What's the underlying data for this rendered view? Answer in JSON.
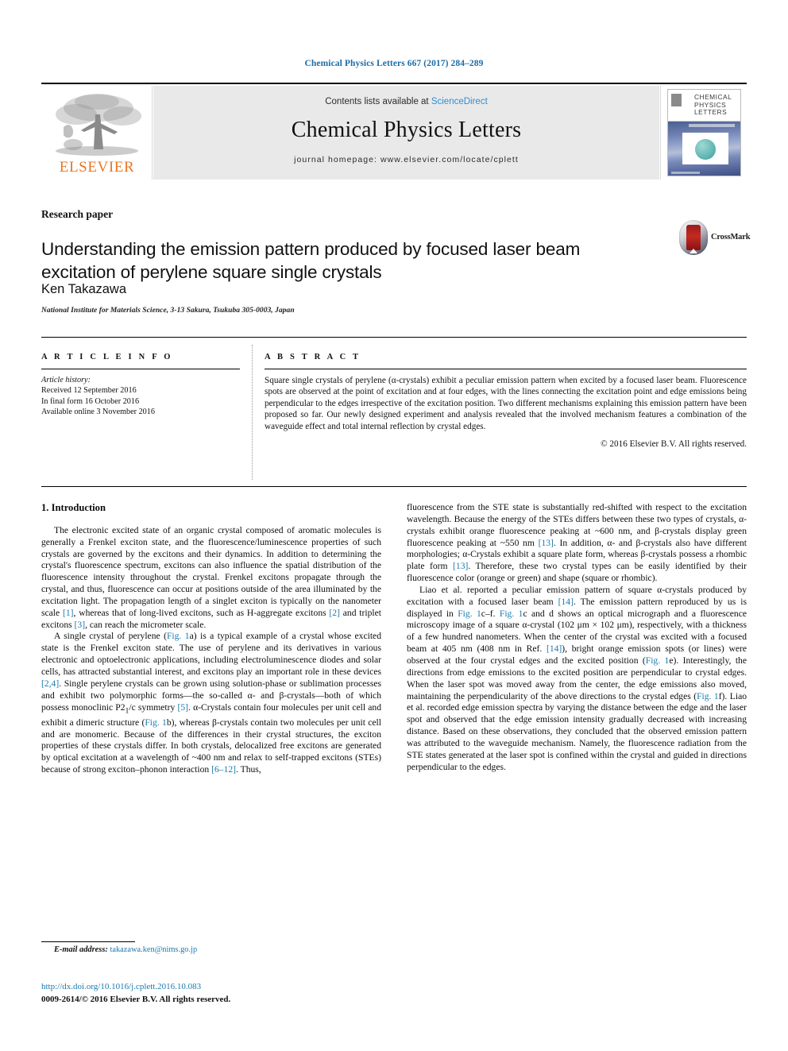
{
  "running_head": "Chemical Physics Letters 667 (2017) 284–289",
  "banner": {
    "contents_prefix": "Contents lists available at ",
    "sciencedirect": "ScienceDirect",
    "journal_name": "Chemical Physics Letters",
    "homepage": "journal homepage: www.elsevier.com/locate/cplett",
    "publisher_logo_text": "ELSEVIER",
    "cover_title_line1": "CHEMICAL",
    "cover_title_line2": "PHYSICS",
    "cover_title_line3": "LETTERS"
  },
  "article": {
    "type": "Research paper",
    "title": "Understanding the emission pattern produced by focused laser beam excitation of perylene square single crystals",
    "author": "Ken Takazawa",
    "affiliation": "National Institute for Materials Science, 3-13 Sakura, Tsukuba 305-0003, Japan",
    "crossmark_label": "CrossMark"
  },
  "article_info": {
    "heading": "A R T I C L E    I N F O",
    "history_label": "Article history:",
    "received": "Received 12 September 2016",
    "final_form": "In final form 16 October 2016",
    "available": "Available online 3 November 2016"
  },
  "abstract": {
    "heading": "A B S T R A C T",
    "text": "Square single crystals of perylene (α-crystals) exhibit a peculiar emission pattern when excited by a focused laser beam. Fluorescence spots are observed at the point of excitation and at four edges, with the lines connecting the excitation point and edge emissions being perpendicular to the edges irrespective of the excitation position. Two different mechanisms explaining this emission pattern have been proposed so far. Our newly designed experiment and analysis revealed that the involved mechanism features a combination of the waveguide effect and total internal reflection by crystal edges.",
    "copyright": "© 2016 Elsevier B.V. All rights reserved."
  },
  "body": {
    "section1_heading": "1. Introduction",
    "left_p1_a": "The electronic excited state of an organic crystal composed of aromatic molecules is generally a Frenkel exciton state, and the fluorescence/luminescence properties of such crystals are governed by the excitons and their dynamics. In addition to determining the crystal's fluorescence spectrum, excitons can also influence the spatial distribution of the fluorescence intensity throughout the crystal. Frenkel excitons propagate through the crystal, and thus, fluorescence can occur at positions outside of the area illuminated by the excitation light. The propagation length of a singlet exciton is typically on the nanometer scale ",
    "ref_1": "[1]",
    "left_p1_b": ", whereas that of long-lived excitons, such as H-aggregate excitons ",
    "ref_2": "[2]",
    "left_p1_c": " and triplet excitons ",
    "ref_3": "[3]",
    "left_p1_d": ", can reach the micrometer scale.",
    "left_p2_a": "A single crystal of perylene (",
    "ref_fig1a": "Fig. 1",
    "left_p2_b": "a) is a typical example of a crystal whose excited state is the Frenkel exciton state. The use of perylene and its derivatives in various electronic and optoelectronic applications, including electroluminescence diodes and solar cells, has attracted substantial interest, and excitons play an important role in these devices ",
    "ref_24": "[2,4]",
    "left_p2_c": ". Single perylene crystals can be grown using solution-phase or sublimation processes and exhibit two polymorphic forms—the so-called α- and β-crystals—both of which possess monoclinic P2",
    "sub_1": "1",
    "left_p2_d": "/c symmetry ",
    "ref_5": "[5]",
    "left_p2_e": ". α-Crystals contain four molecules per unit cell and exhibit a dimeric structure (",
    "ref_fig1b": "Fig. 1",
    "left_p2_f": "b), whereas β-crystals contain two molecules per unit cell and are monomeric. Because of the differences in their crystal structures, the exciton properties of these crystals differ. In both crystals, delocalized free excitons are generated by optical excitation at a wavelength of ~400 nm and relax to self-trapped excitons (STEs) because of strong exciton–phonon interaction ",
    "ref_612": "[6–12]",
    "left_p2_g": ". Thus,",
    "right_p1_a": "fluorescence from the STE state is substantially red-shifted with respect to the excitation wavelength. Because the energy of the STEs differs between these two types of crystals, α-crystals exhibit orange fluorescence peaking at ~600 nm, and β-crystals display green fluorescence peaking at ~550 nm ",
    "ref_13a": "[13]",
    "right_p1_b": ". In addition, α- and β-crystals also have different morphologies; α-Crystals exhibit a square plate form, whereas β-crystals possess a rhombic plate form ",
    "ref_13b": "[13]",
    "right_p1_c": ". Therefore, these two crystal types can be easily identified by their fluorescence color (orange or green) and shape (square or rhombic).",
    "right_p2_a": "Liao et al. reported a peculiar emission pattern of square α-crystals produced by excitation with a focused laser beam ",
    "ref_14a": "[14]",
    "right_p2_b": ". The emission pattern reproduced by us is displayed in ",
    "ref_fig1cf": "Fig. 1",
    "right_p2_c": "c–f. ",
    "ref_fig1c": "Fig. 1",
    "right_p2_d": "c and d shows an optical micrograph and a fluorescence microscopy image of a square α-crystal (102 μm × 102 μm), respectively, with a thickness of a few hundred nanometers. When the center of the crystal was excited with a focused beam at 405 nm (408 nm in Ref. ",
    "ref_14b": "[14]",
    "right_p2_e": "), bright orange emission spots (or lines) were observed at the four crystal edges and the excited position (",
    "ref_fig1e": "Fig. 1",
    "right_p2_f": "e). Interestingly, the directions from edge emissions to the excited position are perpendicular to crystal edges. When the laser spot was moved away from the center, the edge emissions also moved, maintaining the perpendicularity of the above directions to the crystal edges (",
    "ref_fig1f": "Fig. 1",
    "right_p2_g": "f). Liao et al. recorded edge emission spectra by varying the distance between the edge and the laser spot and observed that the edge emission intensity gradually decreased with increasing distance. Based on these observations, they concluded that the observed emission pattern was attributed to the waveguide mechanism. Namely, the fluorescence radiation from the STE states generated at the laser spot is confined within the crystal and guided in directions perpendicular to the edges."
  },
  "footer": {
    "email_label": "E-mail address:",
    "email": "takazawa.ken@nims.go.jp",
    "doi": "http://dx.doi.org/10.1016/j.cplett.2016.10.083",
    "issn_line": "0009-2614/© 2016 Elsevier B.V. All rights reserved."
  },
  "colors": {
    "link": "#1a7aad",
    "running_head": "#1a6ca8",
    "elsevier_orange": "#e87722",
    "sciencedirect": "#2b8fd4"
  }
}
